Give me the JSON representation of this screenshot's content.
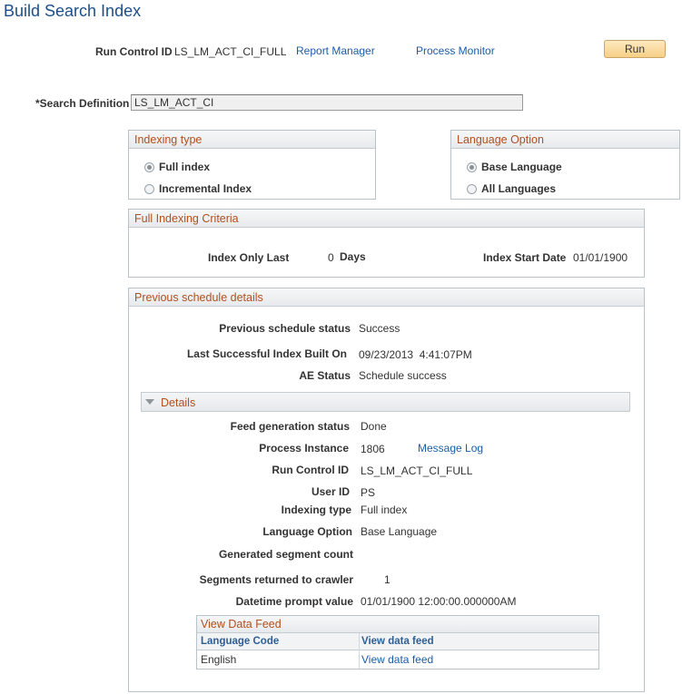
{
  "page": {
    "title": "Build Search Index"
  },
  "run_control": {
    "label": "Run Control ID",
    "value": "LS_LM_ACT_CI_FULL",
    "report_manager": "Report Manager",
    "process_monitor": "Process Monitor",
    "run_label": "Run"
  },
  "search_definition": {
    "label": "*Search Definition",
    "value": "LS_LM_ACT_CI"
  },
  "indexing_type": {
    "title": "Indexing type",
    "options": [
      {
        "label": "Full index",
        "selected": true
      },
      {
        "label": "Incremental Index",
        "selected": false
      }
    ]
  },
  "language_option": {
    "title": "Language Option",
    "options": [
      {
        "label": "Base Language",
        "selected": true
      },
      {
        "label": "All Languages",
        "selected": false
      }
    ]
  },
  "full_criteria": {
    "title": "Full Indexing Criteria",
    "index_only_last_label": "Index Only Last",
    "index_only_last_value": "0",
    "days_label": "Days",
    "start_date_label": "Index Start Date",
    "start_date_value": "01/01/1900"
  },
  "previous_schedule": {
    "title": "Previous schedule details",
    "status_label": "Previous schedule status",
    "status_value": "Success",
    "last_built_label": "Last Successful Index Built On",
    "last_built_value": "09/23/2013  4:41:07PM",
    "ae_status_label": "AE Status",
    "ae_status_value": "Schedule success"
  },
  "details": {
    "title": "Details",
    "feed_status_label": "Feed generation status",
    "feed_status_value": "Done",
    "process_instance_label": "Process Instance",
    "process_instance_value": "1806",
    "message_log": "Message Log",
    "run_control_label": "Run Control ID",
    "run_control_value": "LS_LM_ACT_CI_FULL",
    "user_id_label": "User ID",
    "user_id_value": "PS",
    "indexing_type_label": "Indexing type",
    "indexing_type_value": "Full index",
    "language_option_label": "Language Option",
    "language_option_value": "Base Language",
    "segment_count_label": "Generated segment count",
    "segments_returned_label": "Segments returned to crawler",
    "segments_returned_value": "1",
    "datetime_prompt_label": "Datetime prompt value",
    "datetime_prompt_value": "01/01/1900 12:00:00.000000AM"
  },
  "data_feed": {
    "title": "View Data Feed",
    "columns": [
      "Language Code",
      "View data feed"
    ],
    "rows": [
      {
        "language": "English",
        "link": "View data feed"
      }
    ]
  }
}
